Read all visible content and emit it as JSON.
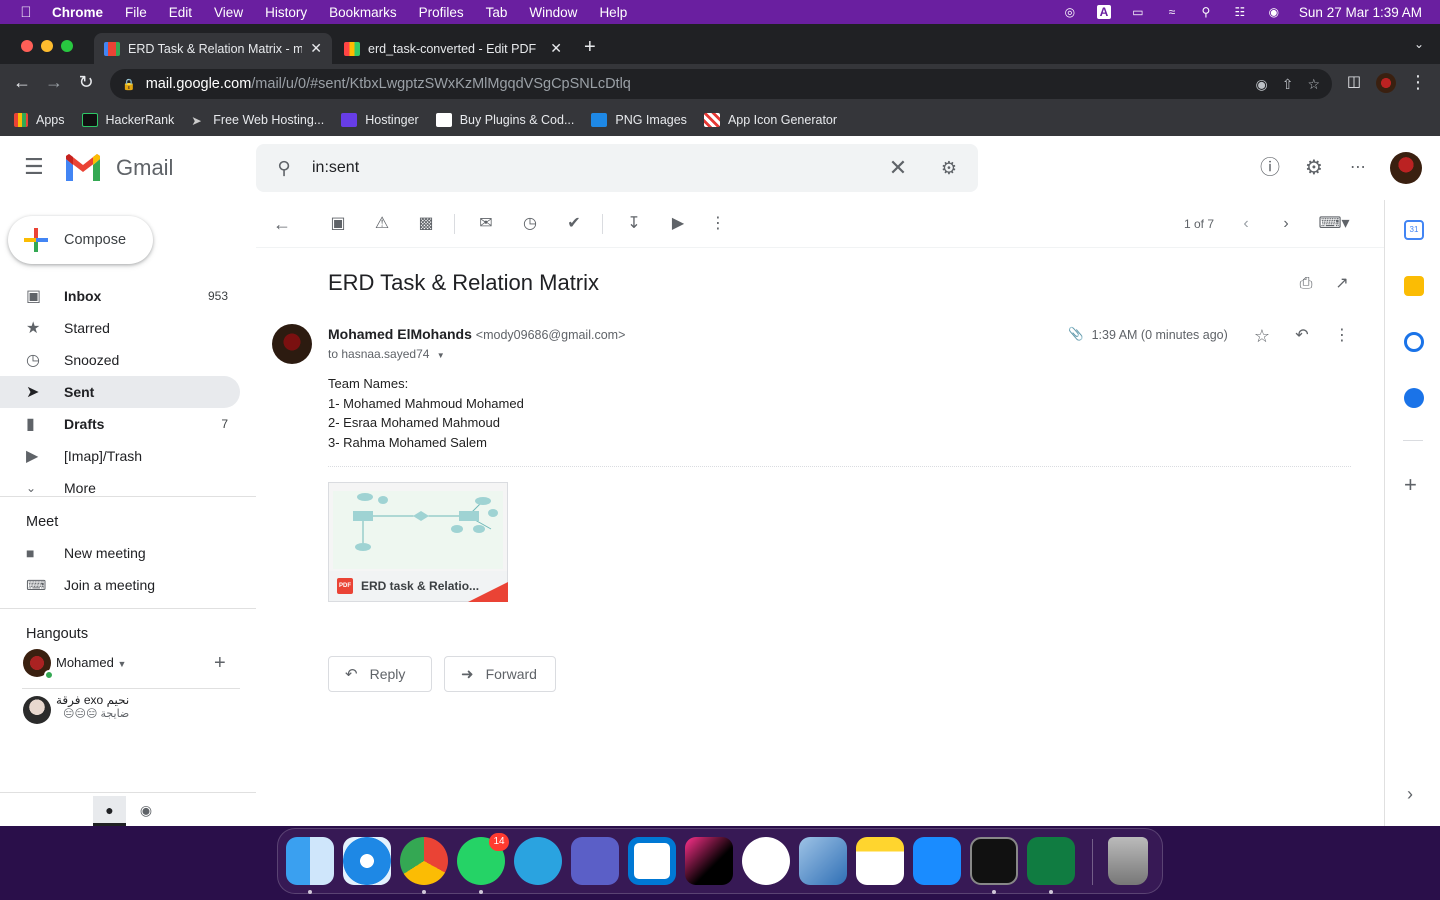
{
  "menubar": {
    "app": "Chrome",
    "items": [
      "File",
      "Edit",
      "View",
      "History",
      "Bookmarks",
      "Profiles",
      "Tab",
      "Window",
      "Help"
    ],
    "clock": "Sun 27 Mar  1:39 AM"
  },
  "browser": {
    "tabs": [
      {
        "title": "ERD Task & Relation Matrix - m",
        "active": true
      },
      {
        "title": "erd_task-converted - Edit PDF",
        "active": false
      }
    ],
    "url_host": "mail.google.com",
    "url_path": "/mail/u/0/#sent/KtbxLwgptzSWxKzMlMgqdVSgCpSNLcDtlq",
    "bookmarks": [
      "Apps",
      "HackerRank",
      "Free Web Hosting...",
      "Hostinger",
      "Buy Plugins & Cod...",
      "PNG Images",
      "App Icon Generator"
    ]
  },
  "gmail": {
    "logo_text": "Gmail",
    "search_value": "in:sent",
    "compose_label": "Compose",
    "nav": [
      {
        "label": "Inbox",
        "count": "953",
        "icon": "inbox-icon"
      },
      {
        "label": "Starred",
        "count": "",
        "icon": "star-icon"
      },
      {
        "label": "Snoozed",
        "count": "",
        "icon": "clock-icon"
      },
      {
        "label": "Sent",
        "count": "",
        "icon": "send-icon"
      },
      {
        "label": "Drafts",
        "count": "7",
        "icon": "draft-icon"
      },
      {
        "label": "[Imap]/Trash",
        "count": "",
        "icon": "label-icon"
      },
      {
        "label": "More",
        "count": "",
        "icon": "chevron-down-icon"
      }
    ],
    "meet": {
      "heading": "Meet",
      "new_meeting": "New meeting",
      "join_meeting": "Join a meeting"
    },
    "hangouts": {
      "heading": "Hangouts",
      "user": "Mohamed",
      "contact_name": "نحيم exo فرقة",
      "contact_status": "ضايجة 😑😑😑"
    },
    "pager": "1 of 7",
    "message": {
      "subject": "ERD Task & Relation Matrix",
      "sender_name": "Mohamed ElMohands",
      "sender_email": "<mody09686@gmail.com>",
      "to": "to hasnaa.sayed74",
      "time": "1:39 AM (0 minutes ago)",
      "body": [
        "Team Names:",
        "1- Mohamed Mahmoud Mohamed",
        "2- Esraa Mohamed Mahmoud",
        "3- Rahma Mohamed Salem"
      ],
      "attachment_name": "ERD task & Relatio...",
      "attachment_type": "PDF"
    },
    "reply_label": "Reply",
    "forward_label": "Forward"
  },
  "dock": {
    "whatsapp_badge": "14"
  },
  "colors": {
    "menubar": "#6a1fa0",
    "chrome_dark": "#202124",
    "chrome_toolbar": "#35363a",
    "gmail_active_nav": "#e8eaed"
  }
}
